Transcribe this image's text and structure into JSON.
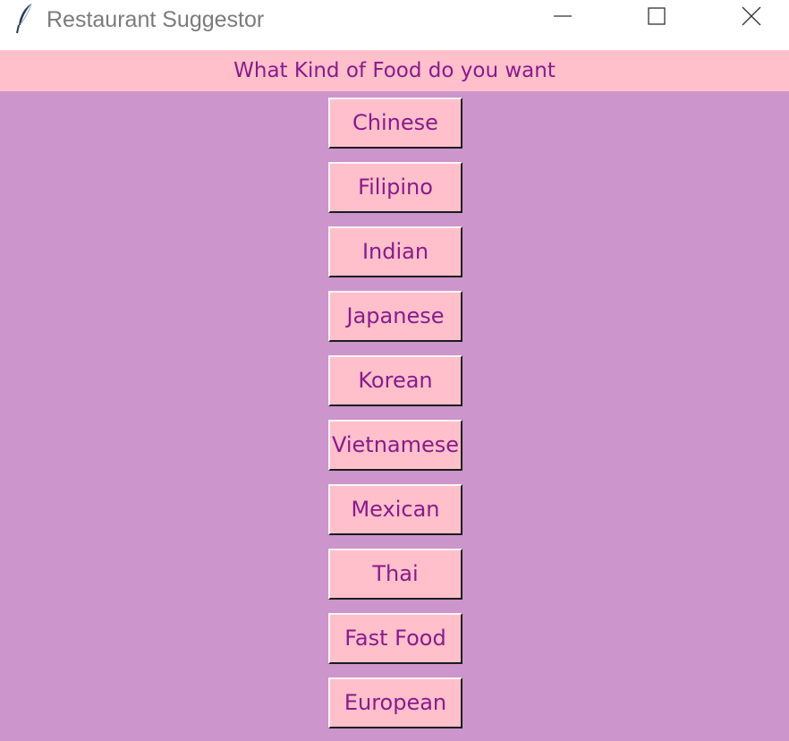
{
  "window": {
    "title": "Restaurant Suggestor",
    "icon": "feather-icon",
    "controls": [
      "minimize-icon",
      "maximize-icon",
      "close-icon"
    ]
  },
  "colors": {
    "client_background": "#cc95cc",
    "label_background": "#ffc0cb",
    "button_background": "#ffc0cb",
    "text": "#8b1a8b"
  },
  "header": {
    "text": "What Kind of Food do you want"
  },
  "buttons": [
    {
      "label": "Chinese"
    },
    {
      "label": "Filipino"
    },
    {
      "label": "Indian"
    },
    {
      "label": "Japanese"
    },
    {
      "label": "Korean"
    },
    {
      "label": "Vietnamese"
    },
    {
      "label": "Mexican"
    },
    {
      "label": "Thai"
    },
    {
      "label": "Fast Food"
    },
    {
      "label": "European"
    }
  ]
}
